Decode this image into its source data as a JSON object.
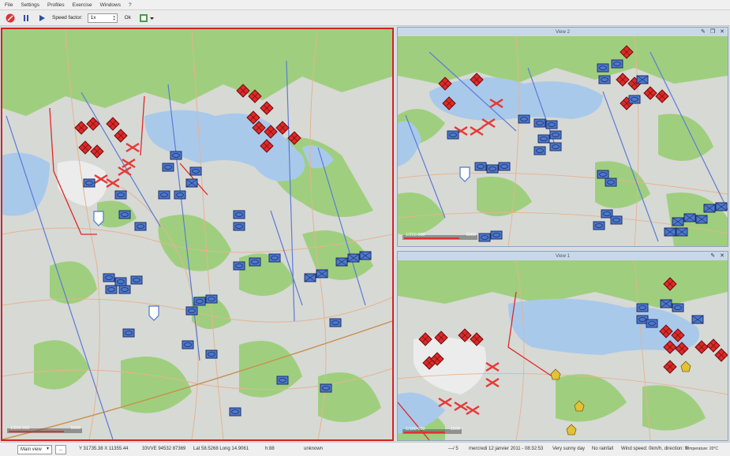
{
  "menu": [
    "File",
    "Settings",
    "Profiles",
    "Exercise",
    "Windows",
    "?"
  ],
  "toolbar": {
    "speed_label": "Speed factor:",
    "speed_value": "1x",
    "ok_label": "Ok"
  },
  "views": {
    "main": {
      "scale_label": "1/200 000",
      "scale_value": "5000"
    },
    "view2": {
      "title": "View 2",
      "scale_label": "1/200 000",
      "scale_value": "5000"
    },
    "view1": {
      "title": "View 1",
      "scale_label": "1/100 000",
      "scale_value": "2500"
    }
  },
  "status": {
    "view_select": "Main view",
    "more": "...",
    "coords": "Y 31735.38 X 11355.44",
    "mgrs": "33VVE 94532 87369",
    "latlong": "Lat 58.5268 Long 14.9061",
    "height": "h:88",
    "terrain": "unknown",
    "fraction": "—/ 5",
    "datetime": "mercredi 12 janvier 2011 - 08:32:53",
    "weather": "Very sunny day",
    "rain": "No rainfall",
    "wind": "Wind speed: 0km/h, direction: 0°",
    "temperature": "Temperature: 20°C"
  },
  "colors": {
    "land": "#d7d9d5",
    "forest": "#9fcf7e",
    "water": "#a9c9ea",
    "road": "#e5b38f",
    "friendly": "#4d78cc",
    "enemy": "#e02828",
    "neutral": "#e3c233",
    "frame_active": "#d42222"
  },
  "icons": {
    "stop": "stop-icon",
    "pause": "pause-icon",
    "play": "play-icon",
    "map_tool": "map-tool-icon"
  }
}
